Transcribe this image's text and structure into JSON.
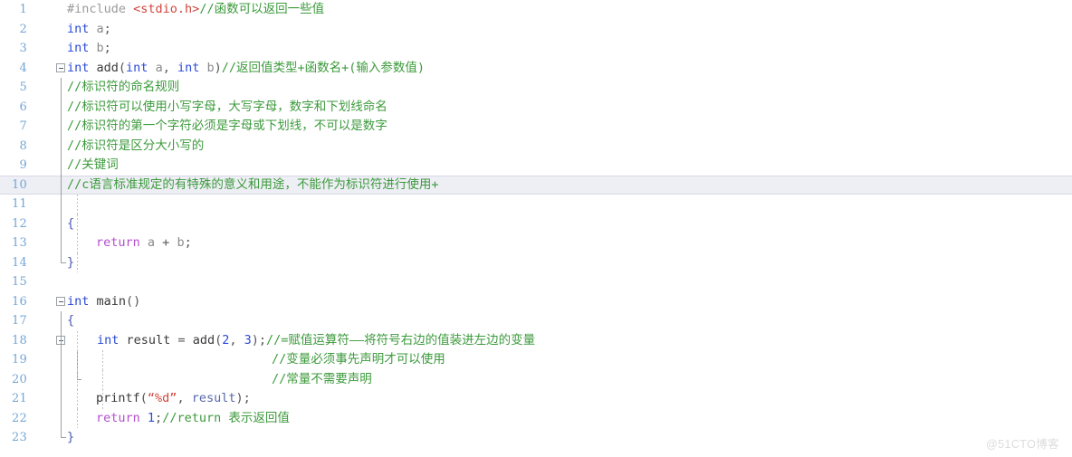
{
  "editor": {
    "kind": "code-editor",
    "language": "C",
    "total_lines": 23,
    "current_line": 10,
    "background_color": "#ffffff",
    "current_line_highlight_color": "#eeeef5",
    "line_number_color": "#73a6d6",
    "comment_color": "#3c9a3c",
    "keyword_color": "#2a4ad7",
    "return_keyword_color": "#b34fd0",
    "string_color": "#d2453c"
  },
  "line_numbers": [
    "1",
    "2",
    "3",
    "4",
    "5",
    "6",
    "7",
    "8",
    "9",
    "10",
    "11",
    "12",
    "13",
    "14",
    "15",
    "16",
    "17",
    "18",
    "19",
    "20",
    "21",
    "22",
    "23"
  ],
  "lines": [
    {
      "n": "1",
      "tokens": [
        {
          "t": "plain",
          "s": "#include "
        },
        {
          "t": "inc",
          "s": "<stdio.h>"
        },
        {
          "t": "comment",
          "s": "//函数可以返回一些值"
        }
      ]
    },
    {
      "n": "2",
      "tokens": [
        {
          "t": "kw",
          "s": "int"
        },
        {
          "t": "ident",
          "s": " a"
        },
        {
          "t": "punct",
          "s": ";"
        }
      ]
    },
    {
      "n": "3",
      "tokens": [
        {
          "t": "kw",
          "s": "int"
        },
        {
          "t": "ident",
          "s": " b"
        },
        {
          "t": "punct",
          "s": ";"
        }
      ]
    },
    {
      "n": "4",
      "tokens": [
        {
          "t": "kw",
          "s": "int"
        },
        {
          "t": "fn",
          "s": " add"
        },
        {
          "t": "punct",
          "s": "("
        },
        {
          "t": "kw",
          "s": "int"
        },
        {
          "t": "ident",
          "s": " a"
        },
        {
          "t": "punct",
          "s": ", "
        },
        {
          "t": "kw",
          "s": "int"
        },
        {
          "t": "ident",
          "s": " b"
        },
        {
          "t": "punct",
          "s": ")"
        },
        {
          "t": "comment",
          "s": "//返回值类型+函数名+(输入参数值)"
        }
      ]
    },
    {
      "n": "5",
      "tokens": [
        {
          "t": "comment",
          "s": "//标识符的命名规则"
        }
      ]
    },
    {
      "n": "6",
      "tokens": [
        {
          "t": "comment",
          "s": "//标识符可以使用小写字母，大写字母，数字和下划线命名"
        }
      ]
    },
    {
      "n": "7",
      "tokens": [
        {
          "t": "comment",
          "s": "//标识符的第一个字符必须是字母或下划线，不可以是数字"
        }
      ]
    },
    {
      "n": "8",
      "tokens": [
        {
          "t": "comment",
          "s": "//标识符是区分大小写的"
        }
      ]
    },
    {
      "n": "9",
      "tokens": [
        {
          "t": "comment",
          "s": "//关键词"
        }
      ]
    },
    {
      "n": "10",
      "tokens": [
        {
          "t": "comment",
          "s": "//c语言标准规定的有特殊的意义和用途，不能作为标识符进行使用+"
        }
      ]
    },
    {
      "n": "11",
      "tokens": []
    },
    {
      "n": "12",
      "tokens": [
        {
          "t": "brace",
          "s": "{"
        }
      ]
    },
    {
      "n": "13",
      "tokens": [
        {
          "t": "ret",
          "s": "return"
        },
        {
          "t": "ident",
          "s": " a "
        },
        {
          "t": "punct",
          "s": "+"
        },
        {
          "t": "ident",
          "s": " b"
        },
        {
          "t": "punct",
          "s": ";"
        }
      ]
    },
    {
      "n": "14",
      "tokens": [
        {
          "t": "brace",
          "s": "}"
        }
      ]
    },
    {
      "n": "15",
      "tokens": []
    },
    {
      "n": "16",
      "tokens": [
        {
          "t": "kw",
          "s": "int"
        },
        {
          "t": "fn",
          "s": " main"
        },
        {
          "t": "punct",
          "s": "()"
        }
      ]
    },
    {
      "n": "17",
      "tokens": [
        {
          "t": "brace",
          "s": "{"
        }
      ]
    },
    {
      "n": "18",
      "tokens": [
        {
          "t": "kw",
          "s": "int"
        },
        {
          "t": "fn",
          "s": " result "
        },
        {
          "t": "punct",
          "s": "= "
        },
        {
          "t": "fn",
          "s": "add"
        },
        {
          "t": "punct",
          "s": "("
        },
        {
          "t": "num",
          "s": "2"
        },
        {
          "t": "punct",
          "s": ", "
        },
        {
          "t": "num",
          "s": "3"
        },
        {
          "t": "punct",
          "s": ");"
        },
        {
          "t": "comment",
          "s": "//=赋值运算符——将符号右边的值装进左边的变量"
        }
      ]
    },
    {
      "n": "19",
      "tokens": [
        {
          "t": "comment",
          "s": "//变量必须事先声明才可以使用"
        }
      ]
    },
    {
      "n": "20",
      "tokens": [
        {
          "t": "comment",
          "s": "//常量不需要声明"
        }
      ]
    },
    {
      "n": "21",
      "tokens": [
        {
          "t": "fn",
          "s": "printf"
        },
        {
          "t": "punct",
          "s": "("
        },
        {
          "t": "str",
          "s": "“%d”"
        },
        {
          "t": "punct",
          "s": ", "
        },
        {
          "t": "var",
          "s": "result"
        },
        {
          "t": "punct",
          "s": ");"
        }
      ]
    },
    {
      "n": "22",
      "tokens": [
        {
          "t": "ret",
          "s": "return"
        },
        {
          "t": "num",
          "s": " 1"
        },
        {
          "t": "punct",
          "s": ";"
        },
        {
          "t": "comment",
          "s": "//return 表示返回值"
        }
      ]
    },
    {
      "n": "23",
      "tokens": [
        {
          "t": "brace",
          "s": "}"
        }
      ]
    }
  ],
  "fold_markers": [
    {
      "line": "4",
      "state": "expanded"
    },
    {
      "line": "16",
      "state": "expanded"
    },
    {
      "line": "18",
      "state": "expanded"
    }
  ],
  "watermark": {
    "text": "@51CTO博客"
  }
}
